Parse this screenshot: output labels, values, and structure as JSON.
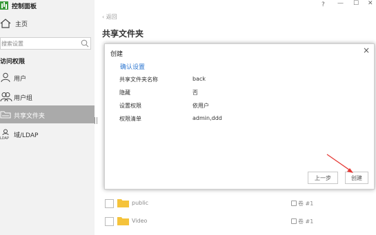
{
  "window": {
    "controls": {
      "help": "?",
      "minimize": "—",
      "maximize": "☐",
      "close": "✕"
    }
  },
  "sidebar": {
    "app_title": "控制面板",
    "home_label": "主页",
    "search_placeholder": "搜索设置",
    "section_title": "访问权限",
    "items": [
      {
        "label": "用户",
        "icon": "user-icon",
        "active": false
      },
      {
        "label": "用户组",
        "icon": "user-group-icon",
        "active": false
      },
      {
        "label": "共享文件夹",
        "icon": "shared-folder-icon",
        "active": true
      },
      {
        "label": "域/LDAP",
        "icon": "ldap-icon",
        "active": false
      }
    ]
  },
  "main": {
    "back_label": "返回",
    "title": "共享文件夹",
    "rows": [
      {
        "name": "public",
        "volume": "卷 #1"
      },
      {
        "name": "Video",
        "volume": "卷 #1"
      }
    ]
  },
  "dialog": {
    "title": "创建",
    "close": "×",
    "confirm_heading": "确认设置",
    "fields": [
      {
        "label": "共享文件夹名称",
        "value": "back"
      },
      {
        "label": "隐藏",
        "value": "否"
      },
      {
        "label": "设置权限",
        "value": "依用户"
      },
      {
        "label": "权限清单",
        "value": "admin,ddd"
      }
    ],
    "prev_button": "上一步",
    "create_button": "创建"
  },
  "colors": {
    "sidebar_bg": "#f2f2f2",
    "active_bg": "#aaaaaa",
    "accent_blue": "#2e77d0",
    "folder_yellow": "#f5c33b",
    "annotation_red": "#e53935"
  }
}
